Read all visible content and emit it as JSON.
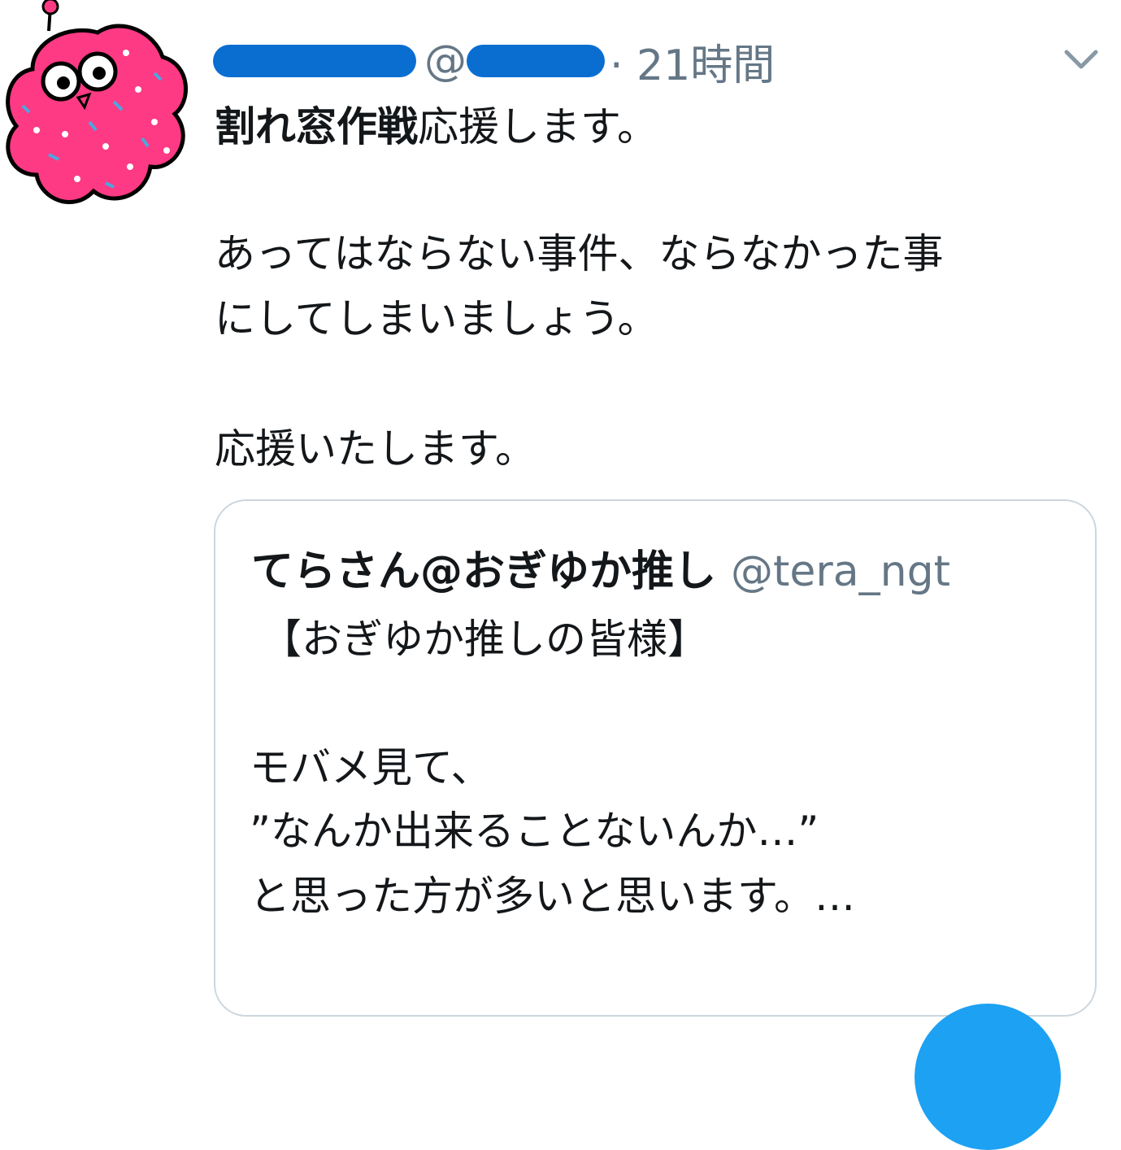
{
  "tweet": {
    "handle_visible": "@",
    "time": "· 21時間",
    "line1_bold": "割れ窓作戦",
    "line1_rest": "応援します。",
    "line2": "あってはならない事件、ならなかった事",
    "line3": "にしてしまいましょう。",
    "line4": "応援いたします。"
  },
  "quoted": {
    "display_name": "てらさん@おぎゆか推し",
    "handle": "@tera_ngt",
    "line1": "【おぎゆか推しの皆様】",
    "line2": "モバメ見て、",
    "line3": "”なんか出来ることないんか…”",
    "line4": "と思った方が多いと思います。…"
  },
  "icons": {
    "avatar": "pink-donut-character-icon",
    "menu": "chevron-down-icon",
    "fab": "compose-tweet-icon"
  },
  "colors": {
    "accent": "#1da1f2",
    "redaction": "#0a6ed1",
    "secondary_text": "#657786",
    "card_border": "#ccd6dd"
  }
}
